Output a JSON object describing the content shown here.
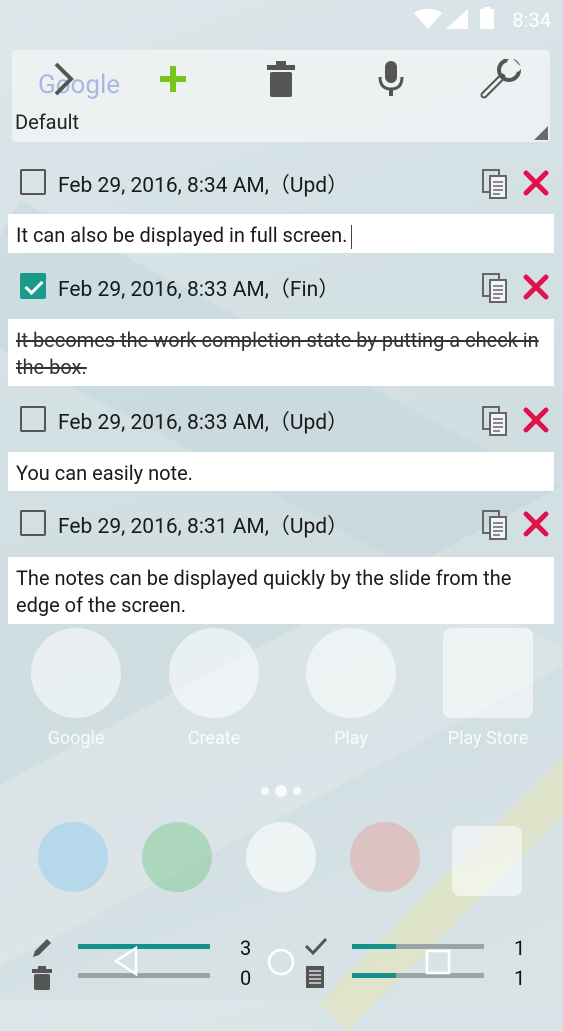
{
  "status_bar": {
    "time": "8:34"
  },
  "toolbar": {
    "icons": [
      "chevron-right-icon",
      "add-icon",
      "trash-icon",
      "microphone-icon",
      "wrench-icon"
    ],
    "category": "Default",
    "background_text": "Google"
  },
  "notes": [
    {
      "date": "Feb 29, 2016, 8:34 AM,（Upd）",
      "checked": false,
      "text": "It can also be displayed in full screen."
    },
    {
      "date": "Feb 29, 2016, 8:33 AM,（Fin）",
      "checked": true,
      "text": "It becomes the work completion state by putting a check in the box."
    },
    {
      "date": "Feb 29, 2016, 8:33 AM,（Upd）",
      "checked": false,
      "text": "You can easily note."
    },
    {
      "date": "Feb 29, 2016, 8:31 AM,（Upd）",
      "checked": false,
      "text": "The notes can be displayed quickly by the slide from the edge of the screen."
    }
  ],
  "home_apps": [
    {
      "label": "Google"
    },
    {
      "label": "Create"
    },
    {
      "label": "Play"
    },
    {
      "label": "Play Store"
    }
  ],
  "bottom_bar": {
    "edit_count": "3",
    "delete_count": "0",
    "done_count": "1",
    "memo_count": "1",
    "edit_progress": 1.0,
    "delete_progress": 0.0,
    "done_progress": 0.33,
    "memo_progress": 0.33
  },
  "colors": {
    "accent": "#13918a",
    "delete": "#e0124a",
    "add": "#7bc41c"
  }
}
